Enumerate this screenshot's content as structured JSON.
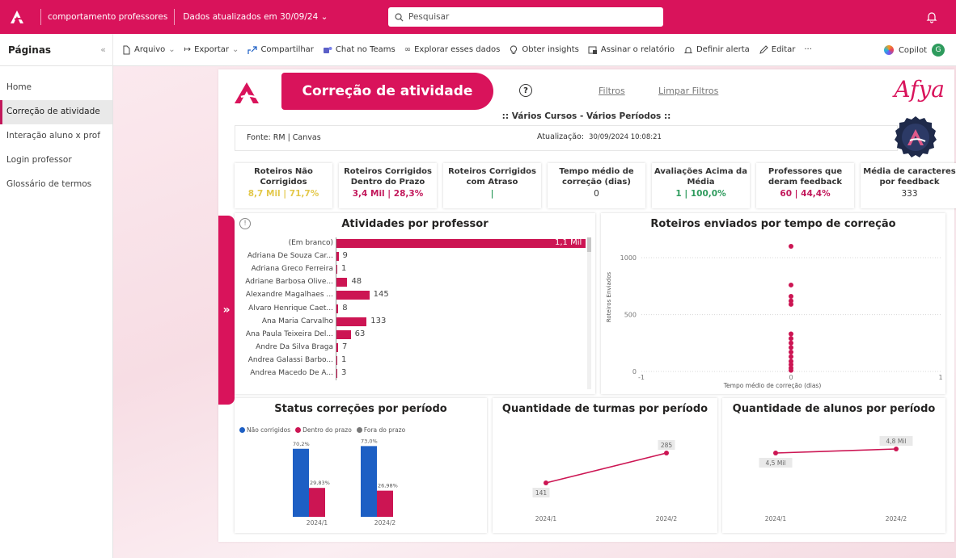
{
  "topbar": {
    "report_name": "comportamento professores",
    "updated": "Dados atualizados em 30/09/24",
    "search_placeholder": "Pesquisar"
  },
  "toolbar": {
    "pages_label": "Páginas",
    "items": [
      "Arquivo",
      "Exportar",
      "Compartilhar",
      "Chat no Teams",
      "Explorar esses dados",
      "Obter insights",
      "Assinar o relatório",
      "Definir alerta",
      "Editar",
      "···"
    ],
    "copilot": "Copilot"
  },
  "sidebar": {
    "items": [
      {
        "label": "Home",
        "active": false
      },
      {
        "label": "Correção de atividade",
        "active": true
      },
      {
        "label": "Interação aluno x prof",
        "active": false
      },
      {
        "label": "Login professor",
        "active": false
      },
      {
        "label": "Glossário de termos",
        "active": false
      }
    ]
  },
  "report": {
    "title": "Correção de atividade",
    "help": "?",
    "filters": "Filtros",
    "clear_filters": "Limpar Filtros",
    "brand": "Afya",
    "subtitle": ":: Vários Cursos - Vários Períodos ::",
    "source": "Fonte: RM | Canvas",
    "updated_label": "Atualização:",
    "updated_value": "30/09/2024 10:08:21",
    "expand": "»"
  },
  "kpis": [
    {
      "title": "Roteiros Não Corrigidos",
      "value": "8,7 Mil | 71,7%",
      "color": "#e3c84a"
    },
    {
      "title": "Roteiros Corrigidos Dentro do Prazo",
      "value": "3,4 Mil | 28,3%",
      "color": "#c2185b"
    },
    {
      "title": "Roteiros Corrigidos com Atraso",
      "value": "|",
      "color": "#2e9b5d"
    },
    {
      "title": "Tempo médio de correção (dias)",
      "value": "0",
      "color": "#333333"
    },
    {
      "title": "Avaliações Acima da Média",
      "value": "1 | 100,0%",
      "color": "#2e9b5d"
    },
    {
      "title": "Professores que deram feedback",
      "value": "60 | 44,4%",
      "color": "#c2185b"
    },
    {
      "title": "Média de caracteres por feedback",
      "value": "333",
      "color": "#333333"
    }
  ],
  "chart_data": [
    {
      "type": "bar",
      "title": "Atividades por professor",
      "orientation": "horizontal",
      "categories": [
        "(Em branco)",
        "Adriana De Souza Car...",
        "Adriana Greco Ferreira",
        "Adriane Barbosa Olive...",
        "Alexandre Magalhaes ...",
        "Alvaro Henrique Caet...",
        "Ana Maria Carvalho",
        "Ana Paula Teixeira Del...",
        "Andre Da Silva Braga",
        "Andrea Galassi Barbo...",
        "Andrea Macedo De A..."
      ],
      "values": [
        1100,
        9,
        1,
        48,
        145,
        8,
        133,
        63,
        7,
        1,
        3
      ],
      "labels": [
        "1,1 Mil",
        "9",
        "1",
        "48",
        "145",
        "8",
        "133",
        "63",
        "7",
        "1",
        "3"
      ],
      "color": "#cc1553"
    },
    {
      "type": "scatter",
      "title": "Roteiros enviados por tempo de correção",
      "xlabel": "Tempo médio de correção (dias)",
      "ylabel": "Roteiros Enviados",
      "xlim": [
        -1,
        1
      ],
      "ylim": [
        0,
        1150
      ],
      "xticks": [
        "-1",
        "0",
        "1"
      ],
      "yticks": [
        "0",
        "500",
        "1000"
      ],
      "points": [
        [
          0,
          1100
        ],
        [
          0,
          760
        ],
        [
          0,
          660
        ],
        [
          0,
          620
        ],
        [
          0,
          590
        ],
        [
          0,
          330
        ],
        [
          0,
          290
        ],
        [
          0,
          250
        ],
        [
          0,
          210
        ],
        [
          0,
          170
        ],
        [
          0,
          130
        ],
        [
          0,
          90
        ],
        [
          0,
          60
        ],
        [
          0,
          30
        ],
        [
          0,
          10
        ]
      ],
      "color": "#cc1553"
    },
    {
      "type": "bar",
      "title": "Status correções por período",
      "categories": [
        "2024/1",
        "2024/2"
      ],
      "series": [
        {
          "name": "Não corrigidos",
          "values": [
            70.2,
            73.0
          ],
          "labels": [
            "70,2%",
            "73,0%"
          ],
          "color": "#1d5fc4"
        },
        {
          "name": "Dentro do prazo",
          "values": [
            29.83,
            26.98
          ],
          "labels": [
            "29,83%",
            "26,98%"
          ],
          "color": "#cc1553"
        },
        {
          "name": "Fora do prazo",
          "values": [
            0,
            0
          ],
          "labels": [
            "",
            ""
          ],
          "color": "#777777"
        }
      ],
      "ylim": [
        0,
        100
      ]
    },
    {
      "type": "line",
      "title": "Quantidade de turmas por período",
      "categories": [
        "2024/1",
        "2024/2"
      ],
      "values": [
        141,
        285
      ],
      "labels": [
        "141",
        "285"
      ],
      "color": "#cc1553"
    },
    {
      "type": "line",
      "title": "Quantidade de alunos por período",
      "categories": [
        "2024/1",
        "2024/2"
      ],
      "values": [
        4.5,
        4.8
      ],
      "labels": [
        "4,5 Mil",
        "4,8 Mil"
      ],
      "color": "#cc1553"
    }
  ]
}
